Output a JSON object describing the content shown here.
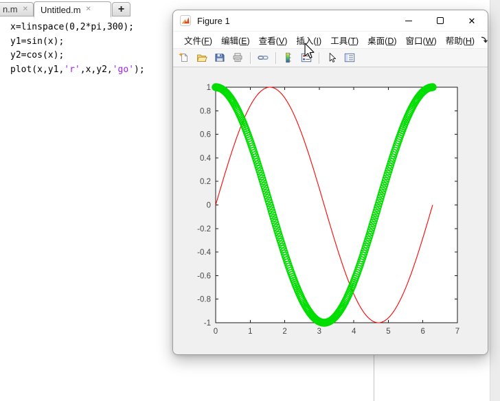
{
  "editor": {
    "tabs": [
      {
        "label": "n.m",
        "active": false,
        "closable": true
      },
      {
        "label": "Untitled.m",
        "active": true,
        "closable": true
      }
    ],
    "new_tab_button": "+",
    "syntax_colors": {
      "code": "#000000",
      "string": "#a020f0"
    },
    "code_lines": [
      [
        {
          "text": "x=linspace(0,2*pi,300);",
          "type": "code"
        }
      ],
      [
        {
          "text": "y1=sin(x);",
          "type": "code"
        }
      ],
      [
        {
          "text": "y2=cos(x);",
          "type": "code"
        }
      ],
      [
        {
          "text": "plot(x,y1,",
          "type": "code"
        },
        {
          "text": "'r'",
          "type": "string"
        },
        {
          "text": ",x,y2,",
          "type": "code"
        },
        {
          "text": "'go'",
          "type": "string"
        },
        {
          "text": ");",
          "type": "code"
        }
      ]
    ]
  },
  "figure_window": {
    "title": "Figure 1",
    "window_controls": [
      "minimize",
      "maximize",
      "close"
    ],
    "menus": [
      {
        "text": "文件",
        "key": "F"
      },
      {
        "text": "编辑",
        "key": "E"
      },
      {
        "text": "查看",
        "key": "V"
      },
      {
        "text": "插入",
        "key": "I"
      },
      {
        "text": "工具",
        "key": "T"
      },
      {
        "text": "桌面",
        "key": "D"
      },
      {
        "text": "窗口",
        "key": "W"
      },
      {
        "text": "帮助",
        "key": "H"
      }
    ],
    "menu_overflow_icon": "collapse-arrow-icon",
    "toolbar_items": [
      {
        "icon": "new-figure-icon"
      },
      {
        "icon": "open-file-icon"
      },
      {
        "icon": "save-figure-icon"
      },
      {
        "icon": "print-figure-icon"
      },
      {
        "separator": true
      },
      {
        "icon": "link-plot-icon"
      },
      {
        "separator": true
      },
      {
        "icon": "insert-colorbar-icon"
      },
      {
        "icon": "insert-legend-icon"
      },
      {
        "separator": true
      },
      {
        "icon": "edit-plot-icon"
      },
      {
        "icon": "plot-tools-icon"
      }
    ]
  },
  "chart_data": {
    "type": "line",
    "title": "",
    "xlabel": "",
    "ylabel": "",
    "x_range": [
      0,
      6.283185307
    ],
    "n_points": 300,
    "xlim": [
      0,
      7
    ],
    "ylim": [
      -1,
      1
    ],
    "xticks": [
      0,
      1,
      2,
      3,
      4,
      5,
      6,
      7
    ],
    "yticks": [
      -1,
      -0.8,
      -0.6,
      -0.4,
      -0.2,
      0,
      0.2,
      0.4,
      0.6,
      0.8,
      1
    ],
    "grid": false,
    "box": true,
    "axes_background": "#ffffff",
    "figure_background": "#f0f0f0",
    "tick_label_color": "#464646",
    "series": [
      {
        "name": "y1=sin(x)",
        "function": "sin",
        "style": "line",
        "color": "#ff0000",
        "line_width": 1.1
      },
      {
        "name": "y2=cos(x)",
        "function": "cos",
        "style": "circles",
        "color": "#00dd00",
        "marker_radius": 5,
        "marker_stroke": 1.4
      }
    ]
  }
}
